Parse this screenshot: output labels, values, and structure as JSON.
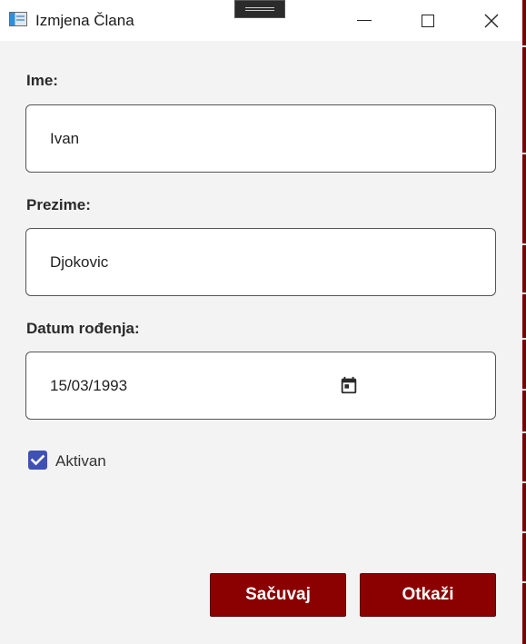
{
  "window": {
    "title": "Izmjena Člana"
  },
  "form": {
    "ime_label": "Ime:",
    "ime_value": "Ivan",
    "prezime_label": "Prezime:",
    "prezime_value": "Djokovic",
    "datum_label": "Datum rođenja:",
    "datum_value": "15/03/1993",
    "aktivan_label": "Aktivan",
    "aktivan_checked": true
  },
  "buttons": {
    "save_label": "Sačuvaj",
    "cancel_label": "Otkaži"
  },
  "colors": {
    "button_bg": "#8b0000",
    "checkbox_accent": "#3f51b5",
    "window_bg": "#f3f3f3"
  },
  "icons": {
    "app": "app-window-icon",
    "calendar": "calendar-icon",
    "check": "checkmark-icon",
    "minimize": "minimize-icon",
    "maximize": "maximize-icon",
    "close": "close-icon"
  }
}
